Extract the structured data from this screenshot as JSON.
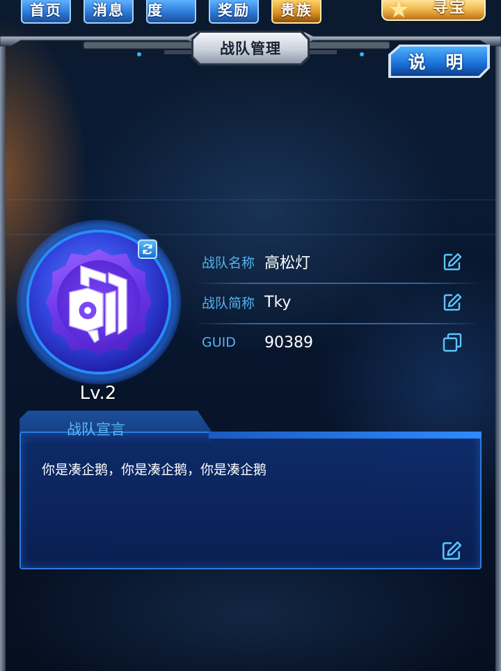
{
  "nav": {
    "items": [
      {
        "label": "首页"
      },
      {
        "label": "消息"
      },
      {
        "label": "活跃度"
      },
      {
        "label": "奖励"
      },
      {
        "label": "贵族"
      }
    ],
    "treasure_label": "寻宝"
  },
  "header": {
    "title": "战队管理",
    "help_label": "说 明"
  },
  "team": {
    "level": "Lv.2",
    "name_label": "战队名称",
    "name_value": "高松灯",
    "short_label": "战队简称",
    "short_value": "Tky",
    "guid_label": "GUID",
    "guid_value": "90389"
  },
  "declaration": {
    "title": "战队宣言",
    "text": "你是凑企鹅，你是凑企鹅，你是凑企鹅"
  },
  "icons": {
    "edit": "edit-icon",
    "copy": "copy-icon",
    "refresh": "refresh-icon"
  },
  "colors": {
    "label_blue": "#53b4f4",
    "panel_blue": "#2d7be0",
    "emblem_purple": "#6a36e8"
  }
}
